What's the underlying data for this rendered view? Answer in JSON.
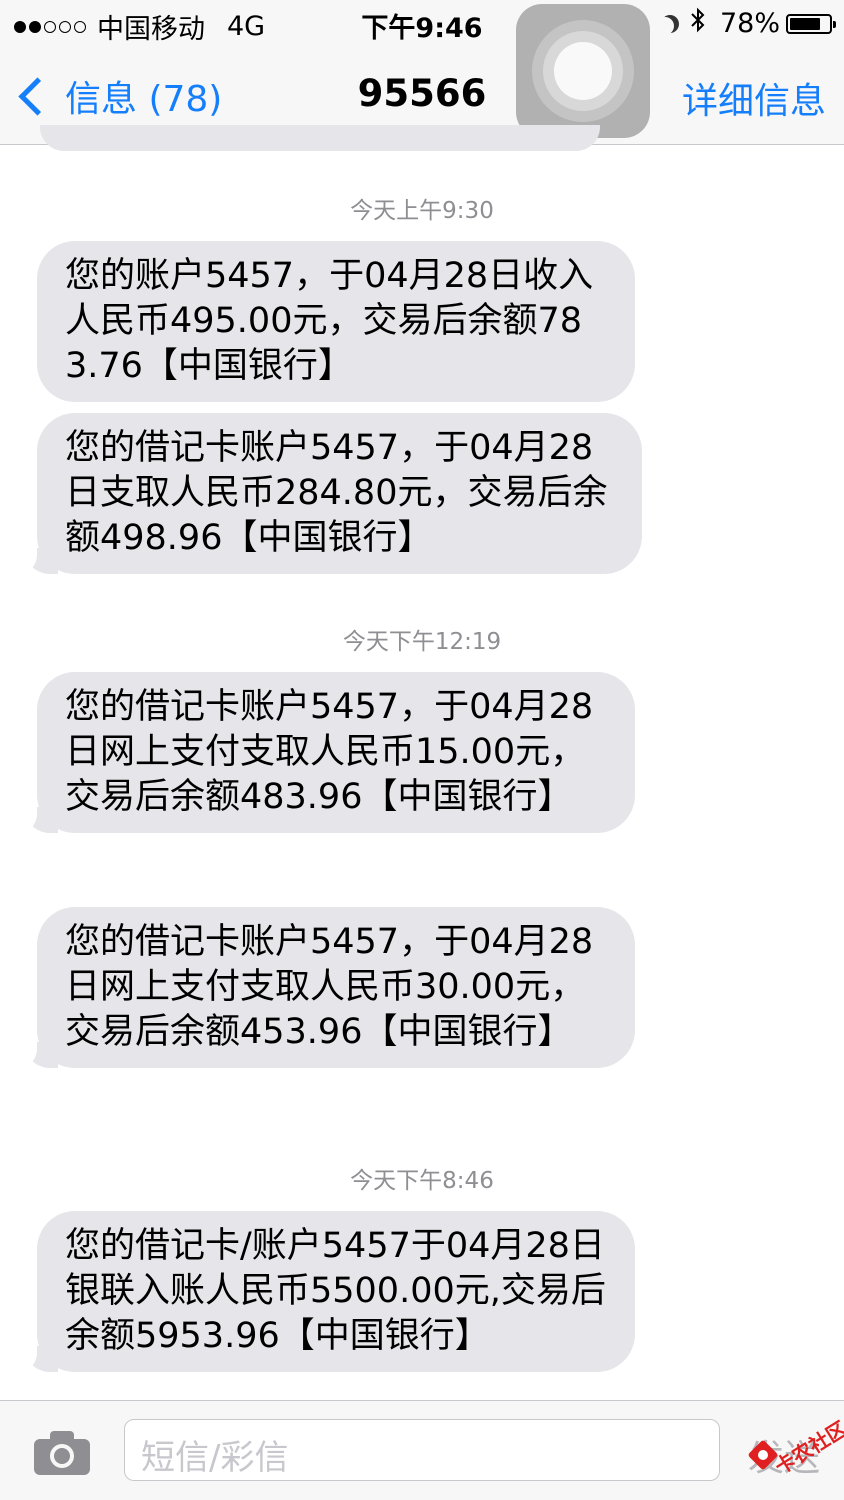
{
  "status_bar": {
    "carrier": "中国移动",
    "network": "4G",
    "time": "下午9:46",
    "battery_percent": "78%",
    "battery_level": 0.78,
    "signal_bars_filled": 2,
    "signal_bars_total": 5
  },
  "nav": {
    "back_label": "信息 (78)",
    "title": "95566",
    "details_label": "详细信息"
  },
  "conversation": {
    "timestamps": [
      "今天上午9:30",
      "今天下午12:19",
      "今天下午8:46"
    ],
    "messages": [
      "您的账户5457，于04月28日收入人民币495.00元，交易后余额783.76【中国银行】",
      "您的借记卡账户5457，于04月28日支取人民币284.80元，交易后余额498.96【中国银行】",
      "您的借记卡账户5457，于04月28日网上支付支取人民币15.00元，交易后余额483.96【中国银行】",
      "您的借记卡账户5457，于04月28日网上支付支取人民币30.00元，交易后余额453.96【中国银行】",
      "您的借记卡/账户5457于04月28日银联入账人民币5500.00元,交易后余额5953.96【中国银行】"
    ]
  },
  "input_bar": {
    "placeholder": "短信/彩信",
    "send_label": "发送"
  },
  "watermark": {
    "text": "卡农社区"
  },
  "colors": {
    "accent": "#157efb",
    "bubble": "#e5e5ea",
    "timestamp": "#8e8e93",
    "bar_background": "#f7f7f7"
  }
}
